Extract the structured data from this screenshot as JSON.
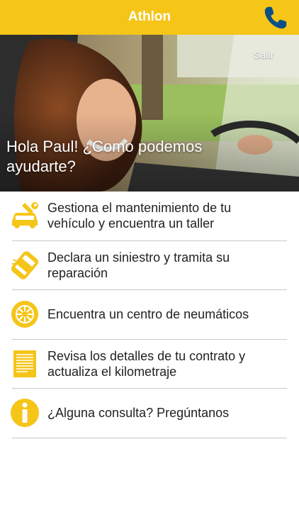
{
  "header": {
    "title": "Athlon",
    "phone_icon": "phone-icon",
    "accent_color": "#f5c518"
  },
  "hero": {
    "logout_label": "Salir",
    "greeting": "Hola Paul! ¿Como podemos ayudarte?"
  },
  "menu": {
    "items": [
      {
        "label": "Gestiona el mantenimiento de tu vehículo y encuentra un taller",
        "icon": "car-wrench-icon"
      },
      {
        "label": "Declara un siniestro y tramita su reparación",
        "icon": "crashed-car-icon"
      },
      {
        "label": "Encuentra un centro de neumáticos",
        "icon": "tire-icon"
      },
      {
        "label": "Revisa los detalles de tu contrato y actualiza el kilometraje",
        "icon": "contract-document-icon"
      },
      {
        "label": "¿Alguna consulta? Pregúntanos",
        "icon": "info-icon"
      }
    ]
  }
}
